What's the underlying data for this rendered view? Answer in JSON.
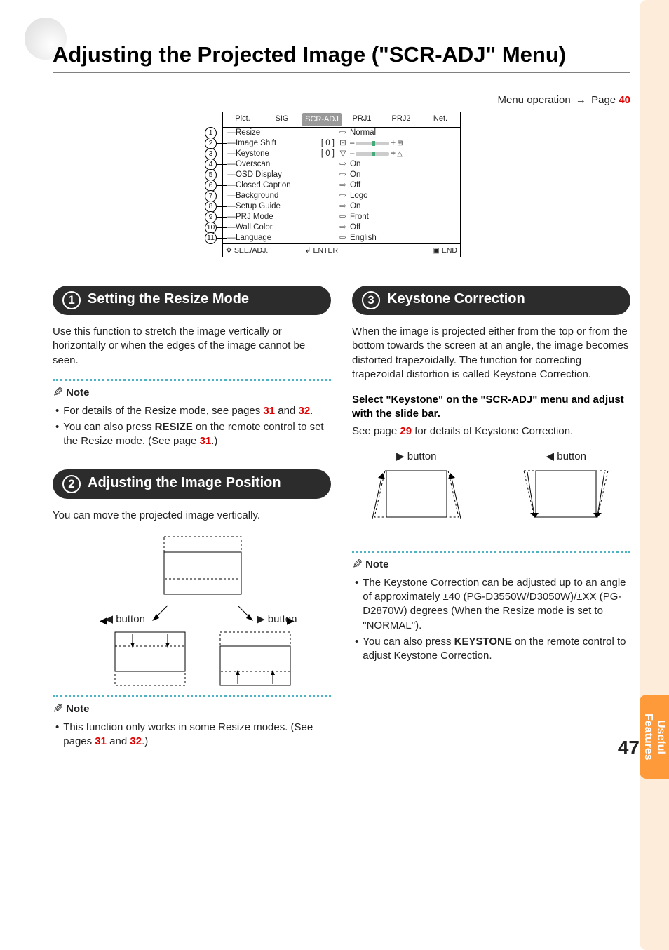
{
  "title": "Adjusting the Projected Image (\"SCR-ADJ\" Menu)",
  "menu_op_prefix": "Menu operation",
  "menu_op_page_label": "Page",
  "menu_op_page": "40",
  "osd": {
    "tabs": [
      "Pict.",
      "SIG",
      "SCR-ADJ",
      "PRJ1",
      "PRJ2",
      "Net."
    ],
    "active_tab": 2,
    "rows": [
      {
        "n": "1",
        "label": "Resize",
        "mid": "",
        "arrow": "⇨",
        "val": "Normal",
        "slider": false
      },
      {
        "n": "2",
        "label": "Image Shift",
        "mid": "[      0 ]",
        "arrow": "",
        "val": "",
        "slider": true,
        "licon": "⊡",
        "ricon": "⊞"
      },
      {
        "n": "3",
        "label": "Keystone",
        "mid": "[      0 ]",
        "arrow": "",
        "val": "",
        "slider": true,
        "licon": "▽",
        "ricon": "△"
      },
      {
        "n": "4",
        "label": "Overscan",
        "mid": "",
        "arrow": "⇨",
        "val": "On",
        "slider": false
      },
      {
        "n": "5",
        "label": "OSD Display",
        "mid": "",
        "arrow": "⇨",
        "val": "On",
        "slider": false
      },
      {
        "n": "6",
        "label": "Closed Caption",
        "mid": "",
        "arrow": "⇨",
        "val": "Off",
        "slider": false
      },
      {
        "n": "7",
        "label": "Background",
        "mid": "",
        "arrow": "⇨",
        "val": "Logo",
        "slider": false
      },
      {
        "n": "8",
        "label": "Setup Guide",
        "mid": "",
        "arrow": "⇨",
        "val": "On",
        "slider": false
      },
      {
        "n": "9",
        "label": "PRJ Mode",
        "mid": "",
        "arrow": "⇨",
        "val": "Front",
        "slider": false
      },
      {
        "n": "10",
        "label": "Wall Color",
        "mid": "",
        "arrow": "⇨",
        "val": "Off",
        "slider": false
      },
      {
        "n": "11",
        "label": "Language",
        "mid": "",
        "arrow": "⇨",
        "val": "English",
        "slider": false
      }
    ],
    "footer": {
      "sel": "SEL./ADJ.",
      "enter": "ENTER",
      "end": "END"
    }
  },
  "s1": {
    "heading": "Setting the Resize Mode",
    "num": "1",
    "body": "Use this function to stretch the image vertically or horizontally or when the edges of the image cannot be seen.",
    "note_label": "Note",
    "note1_a": "For details of the Resize mode, see pages ",
    "note1_p1": "31",
    "note1_and": " and ",
    "note1_p2": "32",
    "note1_end": ".",
    "note2_a": "You can also press ",
    "note2_bold": "RESIZE",
    "note2_b": " on the remote control to set the Resize mode. (See page ",
    "note2_p": "31",
    "note2_end": ".)"
  },
  "s2": {
    "heading": "Adjusting the Image Position",
    "num": "2",
    "body": "You can move the projected image vertically.",
    "left_btn": "button",
    "right_btn": "button",
    "note_label": "Note",
    "note1_a": "This function only works in some Resize modes. (See pages ",
    "note1_p1": "31",
    "note1_and": " and ",
    "note1_p2": "32",
    "note1_end": ".)"
  },
  "s3": {
    "heading": "Keystone Correction",
    "num": "3",
    "body": "When the image is projected either from the top or from the bottom towards the screen at an angle, the image becomes distorted trapezoidally. The function for correcting trapezoidal distortion is called Keystone Correction.",
    "instr_bold": "Select \"Keystone\" on the \"SCR-ADJ\" menu and adjust with the slide bar.",
    "instr_a": "See page ",
    "instr_p": "29",
    "instr_b": " for details of Keystone Correction.",
    "right_btn": "button",
    "left_btn": "button",
    "note_label": "Note",
    "note1": "The Keystone Correction can be adjusted up to an angle of approximately ±40 (PG-D3550W/D3050W)/±XX (PG-D2870W) degrees (When the Resize mode is set to \"NORMAL\").",
    "note2_a": "You can also press ",
    "note2_bold": "KEYSTONE",
    "note2_b": " on the remote control to adjust Keystone Correction."
  },
  "side_tab": "Useful Features",
  "page_num": "47"
}
